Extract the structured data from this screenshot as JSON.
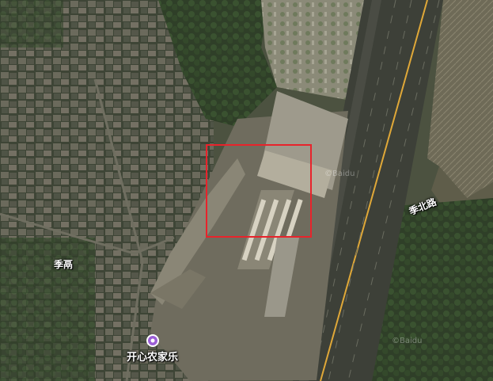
{
  "map": {
    "road_labels": {
      "jiyu": "季鬲",
      "jibei_road": "季北路"
    },
    "poi": {
      "name": "开心农家乐",
      "icon": "poi-marker-icon",
      "color": "#9c5fd6"
    },
    "watermark": "©Baidu",
    "selection_color": "#e8232b"
  }
}
